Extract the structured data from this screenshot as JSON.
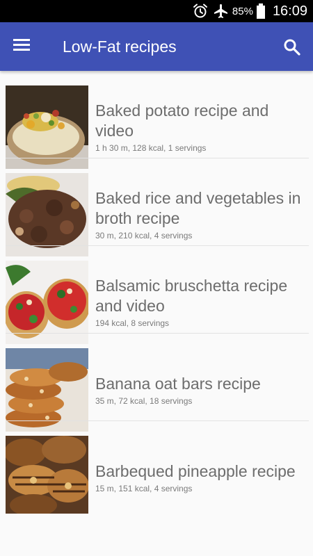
{
  "status_bar": {
    "battery_percent": "85%",
    "time": "16:09",
    "icons": [
      "alarm-icon",
      "airplane-mode-icon",
      "battery-icon"
    ]
  },
  "app_bar": {
    "title": "Low-Fat recipes",
    "menu_icon": "hamburger-menu-icon",
    "search_icon": "search-icon",
    "color": "#3f51b5"
  },
  "recipes": [
    {
      "title": "Baked potato recipe and video",
      "meta": "1 h 30 m, 128 kcal, 1 servings"
    },
    {
      "title": "Baked rice and vegetables in broth recipe",
      "meta": "30 m, 210 kcal, 4 servings"
    },
    {
      "title": "Balsamic bruschetta recipe and video",
      "meta": "194 kcal, 8 servings"
    },
    {
      "title": "Banana oat bars recipe",
      "meta": "35 m, 72 kcal, 18 servings"
    },
    {
      "title": "Barbequed pineapple recipe",
      "meta": "15 m, 151 kcal, 4 servings"
    }
  ]
}
